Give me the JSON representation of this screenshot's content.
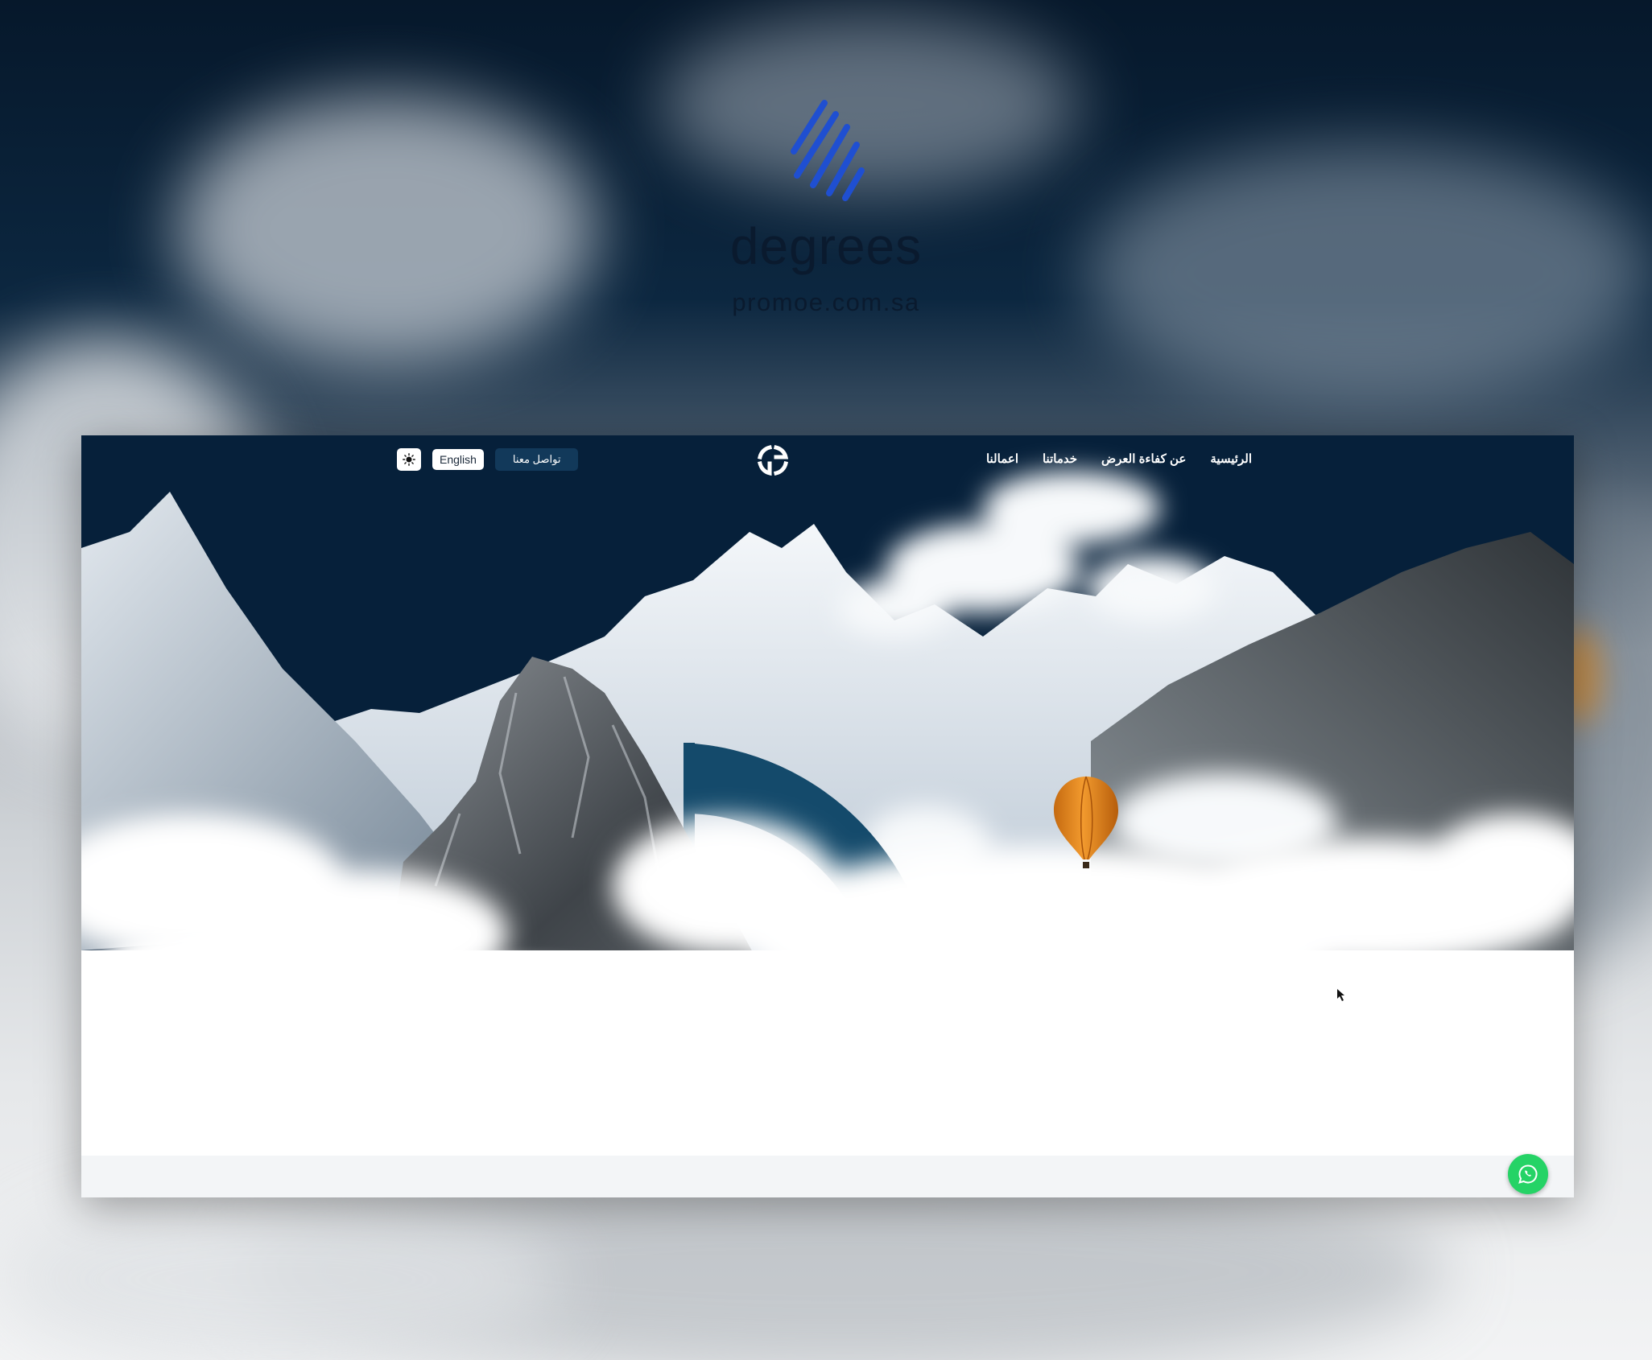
{
  "brand": {
    "name": "degrees",
    "url": "promoe.com.sa",
    "mark_icon": "diagonal-stripes-logo-icon",
    "mark_color": "#1f4fd1"
  },
  "site": {
    "nav": {
      "links": [
        "الرئيسية",
        "عن كفاءة العرض",
        "خدماتنا",
        "اعمالنا"
      ],
      "logo_icon": "degrees-logo-icon",
      "language_label": "English",
      "contact_label": "تواصل معنا",
      "theme_toggle_icon": "sun-icon"
    },
    "hero": {
      "background_color": "#06203a",
      "accent_color": "#144a6b",
      "balloon_color": "#e8891e"
    },
    "whatsapp_icon": "whatsapp-icon",
    "whatsapp_color": "#25d366"
  }
}
